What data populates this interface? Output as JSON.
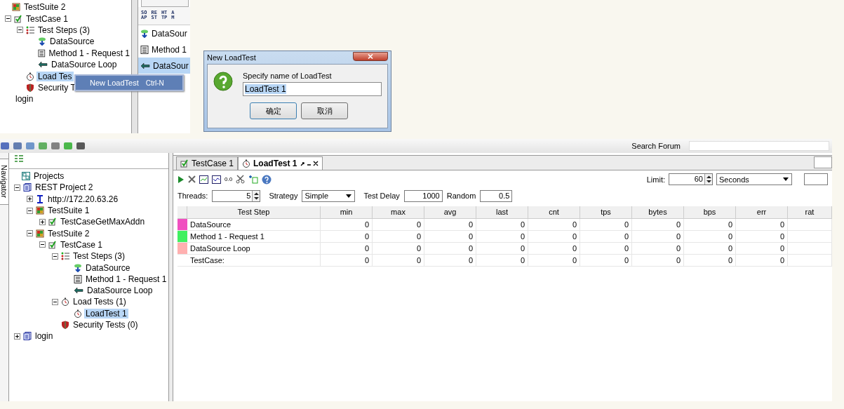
{
  "snippet": {
    "tree": [
      {
        "label": "TestSuite 2",
        "kind": "suite",
        "selected": false,
        "children": [
          {
            "label": "TestCase 1",
            "kind": "case",
            "selected": false,
            "expanded": true,
            "children": [
              {
                "label": "Test Steps (3)",
                "kind": "steps",
                "selected": false,
                "expanded": true,
                "children": [
                  {
                    "label": "DataSource",
                    "kind": "datasource",
                    "selected": false
                  },
                  {
                    "label": "Method 1 - Request 1",
                    "kind": "rest",
                    "selected": false
                  },
                  {
                    "label": "DataSource Loop",
                    "kind": "loop",
                    "selected": false
                  }
                ]
              },
              {
                "label": "Load Tes",
                "kind": "loadtest",
                "selected": true
              },
              {
                "label": "Security T",
                "kind": "security",
                "selected": false
              }
            ]
          }
        ]
      },
      {
        "label": "login",
        "kind": "none",
        "selected": false
      }
    ],
    "step_tools": [
      {
        "top": "SO",
        "bottom": "AP"
      },
      {
        "top": "RE",
        "bottom": "ST"
      },
      {
        "top": "HT",
        "bottom": "TP"
      },
      {
        "top": "A",
        "bottom": "M"
      }
    ],
    "steps": [
      {
        "label": "DataSour",
        "kind": "datasource",
        "selected": false
      },
      {
        "label": "Method 1",
        "kind": "rest",
        "selected": false
      },
      {
        "label": "DataSour",
        "kind": "loop",
        "selected": true
      }
    ],
    "context_menu": [
      {
        "label": "New LoadTest",
        "shortcut": "Ctrl-N"
      }
    ]
  },
  "dialog": {
    "title": "New LoadTest",
    "message": "Specify name of LoadTest",
    "value": "LoadTest 1",
    "buttons": [
      {
        "label": "确定",
        "default": true
      },
      {
        "label": "取消",
        "default": false
      }
    ]
  },
  "window": {
    "search": {
      "label": "Search Forum"
    },
    "navigator_tab": "Navigator",
    "tree": [
      {
        "label": "Projects",
        "kind": "projects",
        "selected": false,
        "children": [
          {
            "label": "REST Project 2",
            "kind": "project",
            "selected": false,
            "expanded": true,
            "children": [
              {
                "label": "http://172.20.63.26",
                "kind": "endpoint",
                "selected": false,
                "expanded": false
              },
              {
                "label": "TestSuite 1",
                "kind": "suite",
                "selected": false,
                "expanded": true,
                "children": [
                  {
                    "label": "TestCaseGetMaxAddn",
                    "kind": "case",
                    "selected": false,
                    "expanded": false
                  }
                ]
              },
              {
                "label": "TestSuite 2",
                "kind": "suite",
                "selected": false,
                "expanded": true,
                "children": [
                  {
                    "label": "TestCase 1",
                    "kind": "case",
                    "selected": false,
                    "expanded": true,
                    "children": [
                      {
                        "label": "Test Steps (3)",
                        "kind": "steps",
                        "selected": false,
                        "expanded": true,
                        "children": [
                          {
                            "label": "DataSource",
                            "kind": "datasource",
                            "selected": false
                          },
                          {
                            "label": "Method 1 - Request 1",
                            "kind": "rest",
                            "selected": false
                          },
                          {
                            "label": "DataSource Loop",
                            "kind": "loop",
                            "selected": false
                          }
                        ]
                      },
                      {
                        "label": "Load Tests (1)",
                        "kind": "loadtest",
                        "selected": false,
                        "expanded": true,
                        "children": [
                          {
                            "label": "LoadTest 1",
                            "kind": "loadtest",
                            "selected": true
                          }
                        ]
                      },
                      {
                        "label": "Security Tests (0)",
                        "kind": "security",
                        "selected": false
                      }
                    ]
                  }
                ]
              }
            ]
          },
          {
            "label": "login",
            "kind": "project",
            "selected": false,
            "expanded": false
          }
        ]
      }
    ],
    "tabs": [
      {
        "label": "TestCase 1",
        "kind": "case",
        "selected": false
      },
      {
        "label": "LoadTest 1",
        "kind": "loadtest",
        "selected": true
      }
    ],
    "stats_button": "0.0",
    "limit": {
      "label": "Limit:",
      "value": "60",
      "unit": "Seconds"
    },
    "params": {
      "threads_label": "Threads:",
      "threads": "5",
      "strategy_label": "Strategy",
      "strategy": "Simple",
      "delay_label": "Test Delay",
      "delay": "1000",
      "random_label": "Random",
      "random": "0.5"
    },
    "table": {
      "columns": [
        "Test Step",
        "min",
        "max",
        "avg",
        "last",
        "cnt",
        "tps",
        "bytes",
        "bps",
        "err",
        "rat"
      ],
      "rows": [
        {
          "step": "DataSource",
          "color": "#f050c0",
          "values": [
            "0",
            "0",
            "0",
            "0",
            "0",
            "0",
            "0",
            "0",
            "0"
          ]
        },
        {
          "step": "Method 1 - Request 1",
          "color": "#40f060",
          "values": [
            "0",
            "0",
            "0",
            "0",
            "0",
            "0",
            "0",
            "0",
            "0"
          ]
        },
        {
          "step": "DataSource Loop",
          "color": "#ffb0b0",
          "values": [
            "0",
            "0",
            "0",
            "0",
            "0",
            "0",
            "0",
            "0",
            "0"
          ]
        },
        {
          "step": "TestCase:",
          "values": [
            "0",
            "0",
            "0",
            "0",
            "0",
            "0",
            "0",
            "0",
            "0"
          ]
        }
      ]
    }
  }
}
